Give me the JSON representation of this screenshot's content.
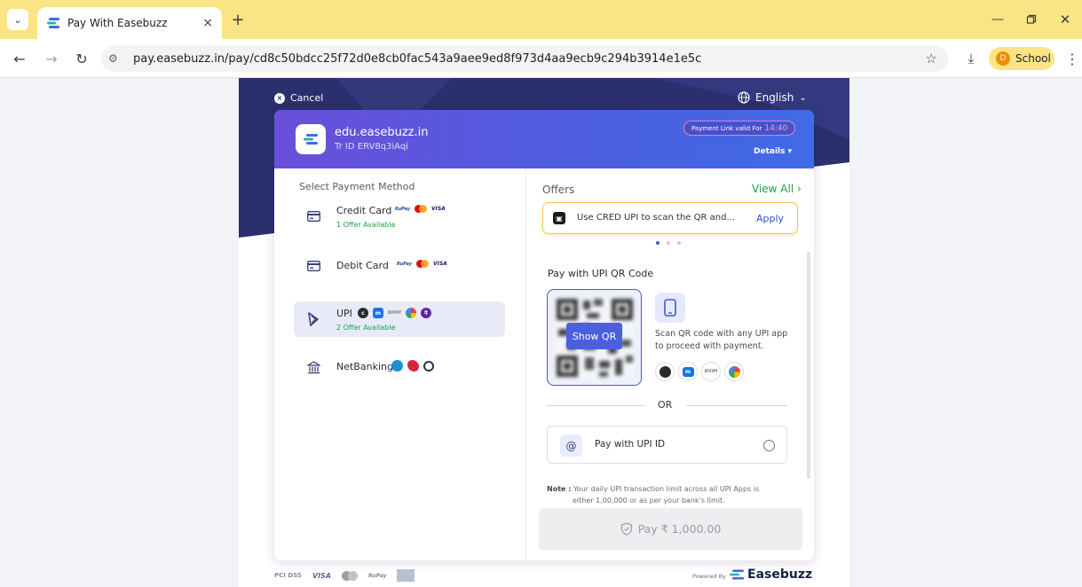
{
  "browser": {
    "tab_title": "Pay With Easebuzz",
    "tab_close": "×",
    "new_tab": "+",
    "url": "pay.easebuzz.in/pay/cd8c50bdcc25f72d0e8cb0fac543a9aee9ed8f973d4aa9ecb9c294b3914e1e5c",
    "profile_initial": "D",
    "profile_name": "School"
  },
  "page": {
    "cancel_label": "Cancel",
    "language": "English"
  },
  "merchant": {
    "name": "edu.easebuzz.in",
    "tr_id": "Tr ID ERV8q3iAqi",
    "link_valid_label": "Payment Link valid For",
    "link_valid_time": "14:40",
    "details_label": "Details ▾"
  },
  "methods": {
    "title": "Select Payment Method",
    "items": [
      {
        "label": "Credit Card",
        "offer": "1 Offer Available"
      },
      {
        "label": "Debit Card",
        "offer": ""
      },
      {
        "label": "UPI",
        "offer": "2 Offer Available"
      },
      {
        "label": "NetBanking",
        "offer": ""
      }
    ],
    "selected": "UPI"
  },
  "offers": {
    "label": "Offers",
    "view_all": "View All ›",
    "card_text": "Use CRED UPI to scan the QR and...",
    "apply_label": "Apply"
  },
  "qr": {
    "title": "Pay with UPI QR Code",
    "show_qr_label": "Show QR",
    "help_text": "Scan QR code with any UPI app to proceed with payment."
  },
  "divider_text": "OR",
  "upi_id": {
    "label": "Pay with UPI ID"
  },
  "note": {
    "prefix": "Note :",
    "line1": "Your daily UPI transaction limit across all UPI Apps is",
    "line2": "either 1,00,000 or as per your bank's limit."
  },
  "pay_button": {
    "label": "Pay ₹ 1,000.00"
  },
  "footer": {
    "powered_by": "Powered By",
    "brand": "Easebuzz",
    "payment_brands": [
      "PCI DSS",
      "VISA",
      "mastercard",
      "RuPay",
      "AMERICAN EXPRESS"
    ]
  },
  "colors": {
    "header_gradient_start": "#6a4fd9",
    "header_gradient_end": "#3f6be6",
    "page_dark": "#2b2f6e",
    "offer_green": "#17a34a",
    "apply_blue": "#2d4fd6",
    "browser_yellow": "#fbe483"
  },
  "icons": {
    "cancel": "close-circle-icon",
    "language": "globe-icon",
    "credit_card": "credit-card-icon",
    "debit_card": "debit-card-icon",
    "upi": "upi-icon",
    "netbanking": "bank-icon",
    "offer": "cred-icon",
    "qr_phone": "mobile-phone-icon",
    "upi_id": "at-sign-icon",
    "pay": "shield-check-icon"
  }
}
